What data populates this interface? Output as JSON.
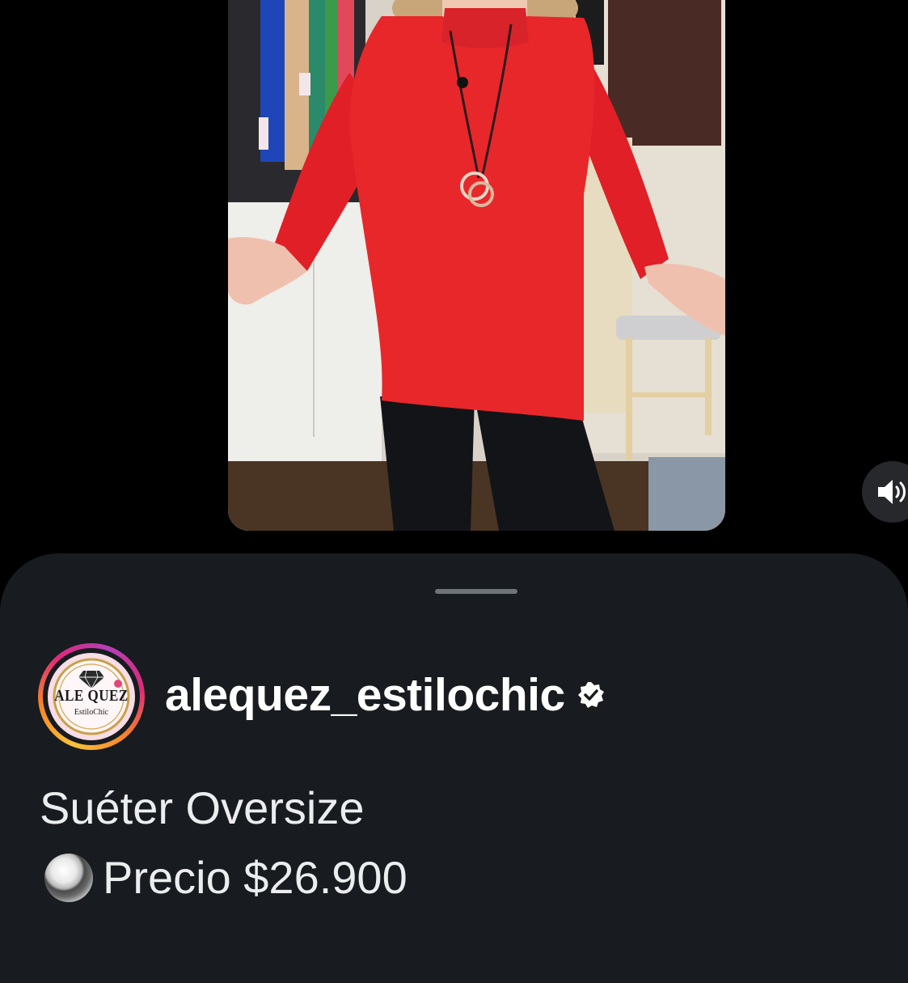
{
  "video": {
    "sound_icon": "speaker-on-icon"
  },
  "sheet": {
    "handle_icon": "drag-handle"
  },
  "account": {
    "avatar": {
      "brand": "ALE QUEZ",
      "sub": "EstiloChic",
      "icon": "diamond-icon"
    },
    "username": "alequez_estilochic",
    "verified_icon": "verified-badge-icon"
  },
  "caption": {
    "title": "Suéter Oversize",
    "price_emoji": "radio-button-icon",
    "price_text": "Precio $26.900"
  },
  "colors": {
    "sheet_background": "#181b1f",
    "sweater_red": "#e8272b",
    "text_primary": "#ffffff",
    "story_ring_start": "#f9c23c",
    "story_ring_end": "#dd2a7b"
  }
}
